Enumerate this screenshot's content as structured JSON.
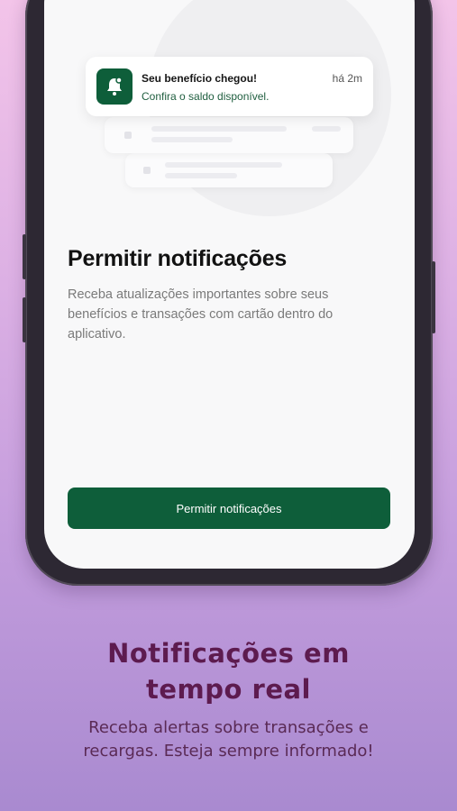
{
  "notification": {
    "icon": "bell-icon",
    "title": "Seu benefício chegou!",
    "subtitle": "Confira o saldo disponível.",
    "time": "há 2m"
  },
  "screen": {
    "title": "Permitir notificações",
    "description": "Receba atualizações importantes sobre seus benefícios e transações com cartão dentro do aplicativo.",
    "button_label": "Permitir notificações"
  },
  "promo": {
    "headline_line1": "Notificações em",
    "headline_line2": "tempo real",
    "subline_line1": "Receba alertas sobre transações e",
    "subline_line2": "recargas. Esteja sempre informado!"
  },
  "colors": {
    "brand_green": "#0e5e3a",
    "headline_purple": "#5d1b4f",
    "background_top": "#f3c4e9",
    "background_bottom": "#a98ad0"
  }
}
